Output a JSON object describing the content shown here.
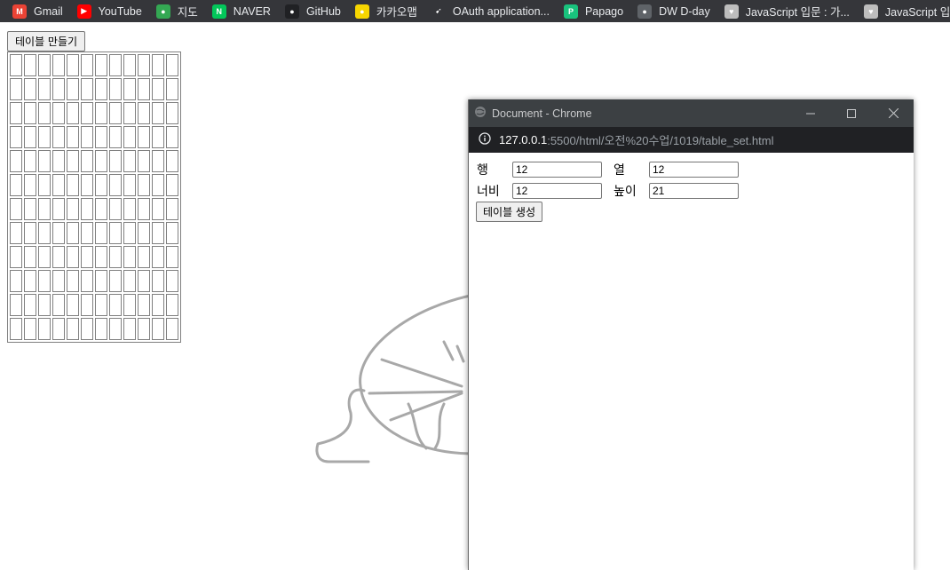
{
  "bookmarks": [
    {
      "label": "Gmail",
      "icon": "gmail-icon",
      "color": "#ea4335",
      "glyph": "M"
    },
    {
      "label": "YouTube",
      "icon": "youtube-icon",
      "color": "#ff0000",
      "glyph": "▶"
    },
    {
      "label": "지도",
      "icon": "maps-icon",
      "color": "#34a853",
      "glyph": "●"
    },
    {
      "label": "NAVER",
      "icon": "naver-icon",
      "color": "#03c75a",
      "glyph": "N"
    },
    {
      "label": "GitHub",
      "icon": "github-icon",
      "color": "#202124",
      "glyph": "●"
    },
    {
      "label": "카카오맵",
      "icon": "kakaomap-icon",
      "color": "#f7d600",
      "glyph": "●"
    },
    {
      "label": "OAuth application...",
      "icon": "oauth-icon",
      "color": "#35363a",
      "glyph": "➹"
    },
    {
      "label": "Papago",
      "icon": "papago-icon",
      "color": "#19c37d",
      "glyph": "P"
    },
    {
      "label": "DW D-day",
      "icon": "globe-icon",
      "color": "#5f6368",
      "glyph": "●"
    },
    {
      "label": "JavaScript 입문 : 가...",
      "icon": "heart-icon",
      "color": "#bdbdbd",
      "glyph": "♥"
    },
    {
      "label": "JavaScript 입문",
      "icon": "heart-icon",
      "color": "#bdbdbd",
      "glyph": "♥"
    }
  ],
  "main": {
    "make_button_label": "테이블 만들기",
    "table": {
      "rows": 12,
      "cols": 12
    }
  },
  "popup": {
    "title": "Document - Chrome",
    "url_host": "127.0.0.1",
    "url_path": ":5500/html/오전%20수업/1019/table_set.html",
    "form": {
      "row_label": "행",
      "row_value": "12",
      "col_label": "열",
      "col_value": "12",
      "width_label": "너비",
      "width_value": "12",
      "height_label": "높이",
      "height_value": "21",
      "submit_label": "테이블 생성"
    }
  }
}
